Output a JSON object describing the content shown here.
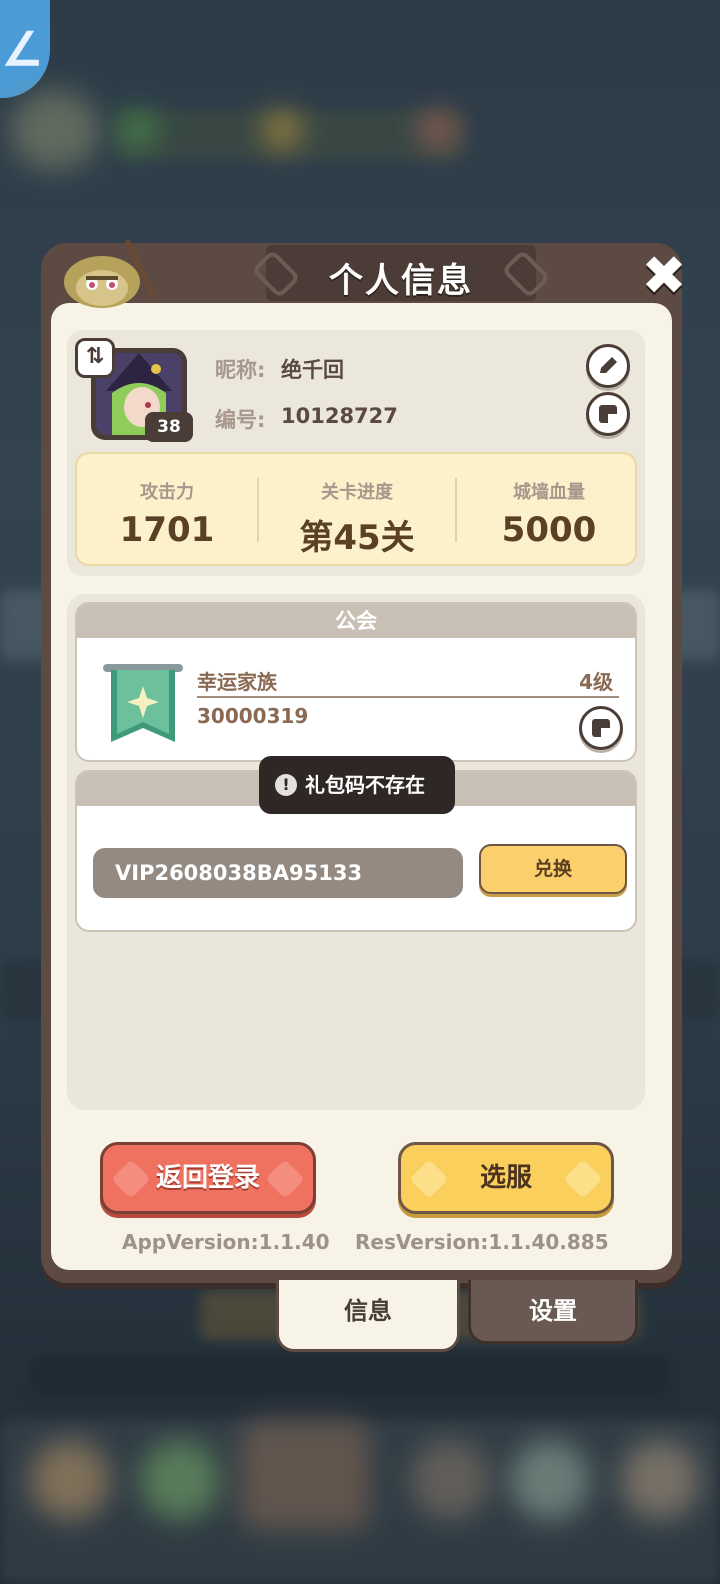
{
  "panel": {
    "title": "个人信息",
    "close_icon": "close-icon"
  },
  "profile": {
    "avatar_level": "38",
    "nickname_label": "昵称:",
    "nickname": "绝千回",
    "id_label": "编号:",
    "id": "10128727",
    "stats": [
      {
        "label": "攻击力",
        "value": "1701"
      },
      {
        "label": "关卡进度",
        "value": "第45关"
      },
      {
        "label": "城墙血量",
        "value": "5000"
      }
    ]
  },
  "guild": {
    "header": "公会",
    "name": "幸运家族",
    "level": "4级",
    "id": "30000319"
  },
  "gift": {
    "code_value": "VIP2608038BA95133",
    "redeem_label": "兑换"
  },
  "toast": {
    "message": "礼包码不存在"
  },
  "buttons": {
    "back_login": "返回登录",
    "select_server": "选服"
  },
  "versions": {
    "app": "AppVersion:1.1.40",
    "res": "ResVersion:1.1.40.885"
  },
  "tabs": {
    "info": "信息",
    "settings": "设置"
  },
  "colors": {
    "panel_border": "#5d4a43",
    "panel_bg": "#f7f3e6",
    "accent_red": "#ef7160",
    "accent_yellow": "#fbcf5c",
    "stats_bg": "#fdf1cc"
  }
}
